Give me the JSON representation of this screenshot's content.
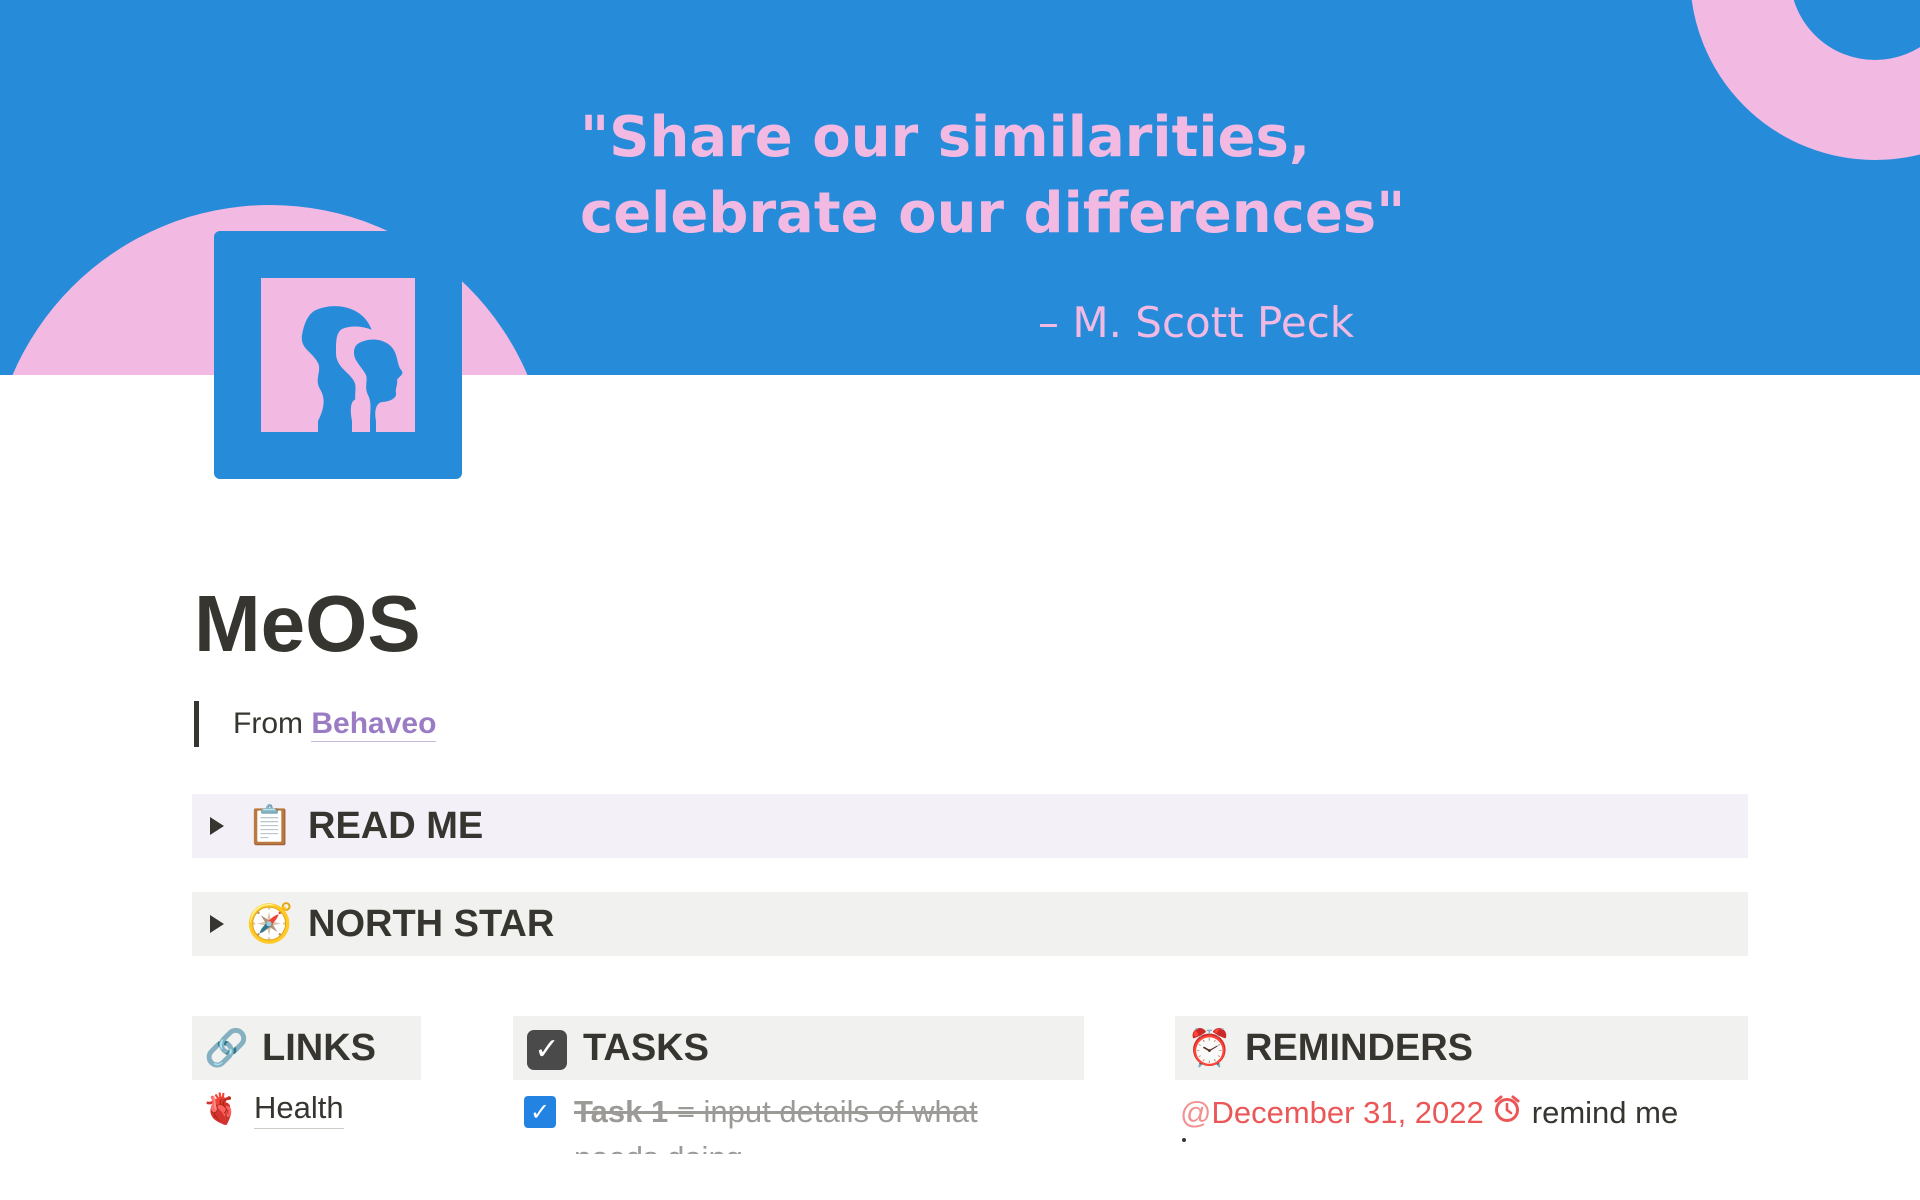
{
  "cover": {
    "quote_line1": "\"Share our similarities,",
    "quote_line2": "celebrate our differences\"",
    "author": "– M. Scott Peck",
    "colors": {
      "background": "#268cd9",
      "accent": "#f2b9e2"
    }
  },
  "page": {
    "icon": "two-faces-profile-icon",
    "title": "MeOS",
    "from_label": "From",
    "from_link": "Behaveo"
  },
  "toggles": [
    {
      "emoji": "📋",
      "label": "READ ME"
    },
    {
      "emoji": "🧭",
      "label": "NORTH STAR"
    }
  ],
  "columns": {
    "links": {
      "emoji": "🔗",
      "label": "LINKS",
      "items": [
        {
          "emoji": "🫀",
          "label": "Health"
        }
      ]
    },
    "tasks": {
      "emoji": "☑",
      "label": "TASKS",
      "items": [
        {
          "checked": true,
          "title": "Task 1",
          "rest": " = input details of what",
          "wrap": "needs doing"
        }
      ]
    },
    "reminders": {
      "emoji": "⏰",
      "label": "REMINDERS",
      "items": [
        {
          "date": "December 31, 2022",
          "note": "remind me"
        }
      ]
    }
  },
  "colors": {
    "link_purple": "#9b7cc4",
    "reminder_red": "#eb5757",
    "checkbox_blue": "#2383e2"
  }
}
